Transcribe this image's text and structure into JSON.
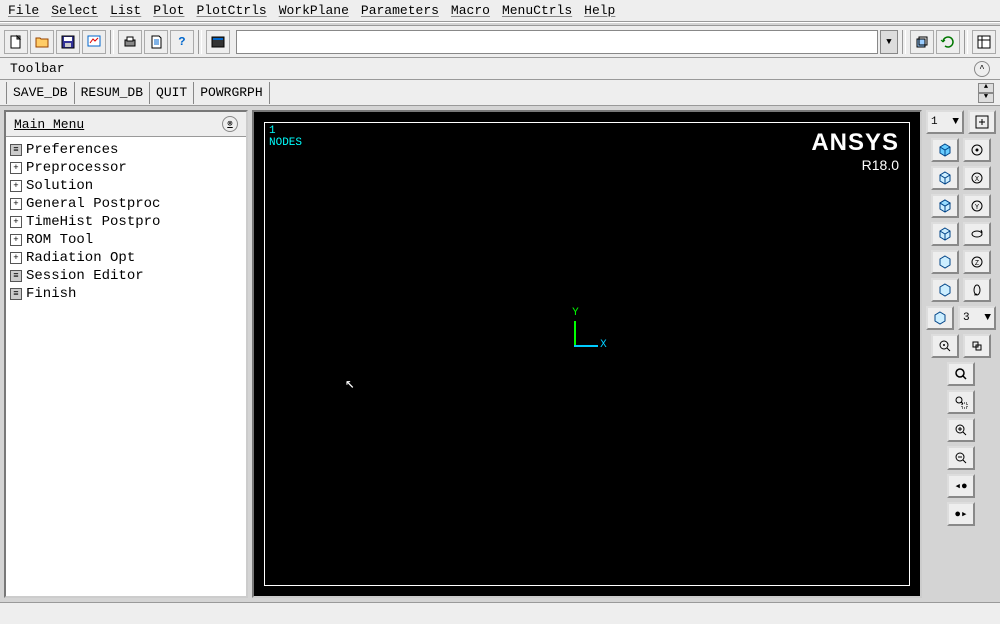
{
  "menubar": [
    "File",
    "Select",
    "List",
    "Plot",
    "PlotCtrls",
    "WorkPlane",
    "Parameters",
    "Macro",
    "MenuCtrls",
    "Help"
  ],
  "toolbar_label": "Toolbar",
  "textbtns": [
    "SAVE_DB",
    "RESUM_DB",
    "QUIT",
    "POWRGRPH"
  ],
  "mainmenu": {
    "title": "Main Menu",
    "items": [
      {
        "icon": "leaf",
        "label": "Preferences"
      },
      {
        "icon": "plus",
        "label": "Preprocessor"
      },
      {
        "icon": "plus",
        "label": "Solution"
      },
      {
        "icon": "plus",
        "label": "General Postproc"
      },
      {
        "icon": "plus",
        "label": "TimeHist Postpro"
      },
      {
        "icon": "plus",
        "label": "ROM Tool"
      },
      {
        "icon": "plus",
        "label": "Radiation Opt"
      },
      {
        "icon": "leaf",
        "label": "Session Editor"
      },
      {
        "icon": "leaf",
        "label": "Finish"
      }
    ]
  },
  "viewport": {
    "num": "1",
    "label": "NODES",
    "brand": "ANSYS",
    "version": "R18.0",
    "y": "Y",
    "x": "X"
  },
  "right": {
    "windowsel": "1",
    "orientsel": "3"
  },
  "command_value": ""
}
